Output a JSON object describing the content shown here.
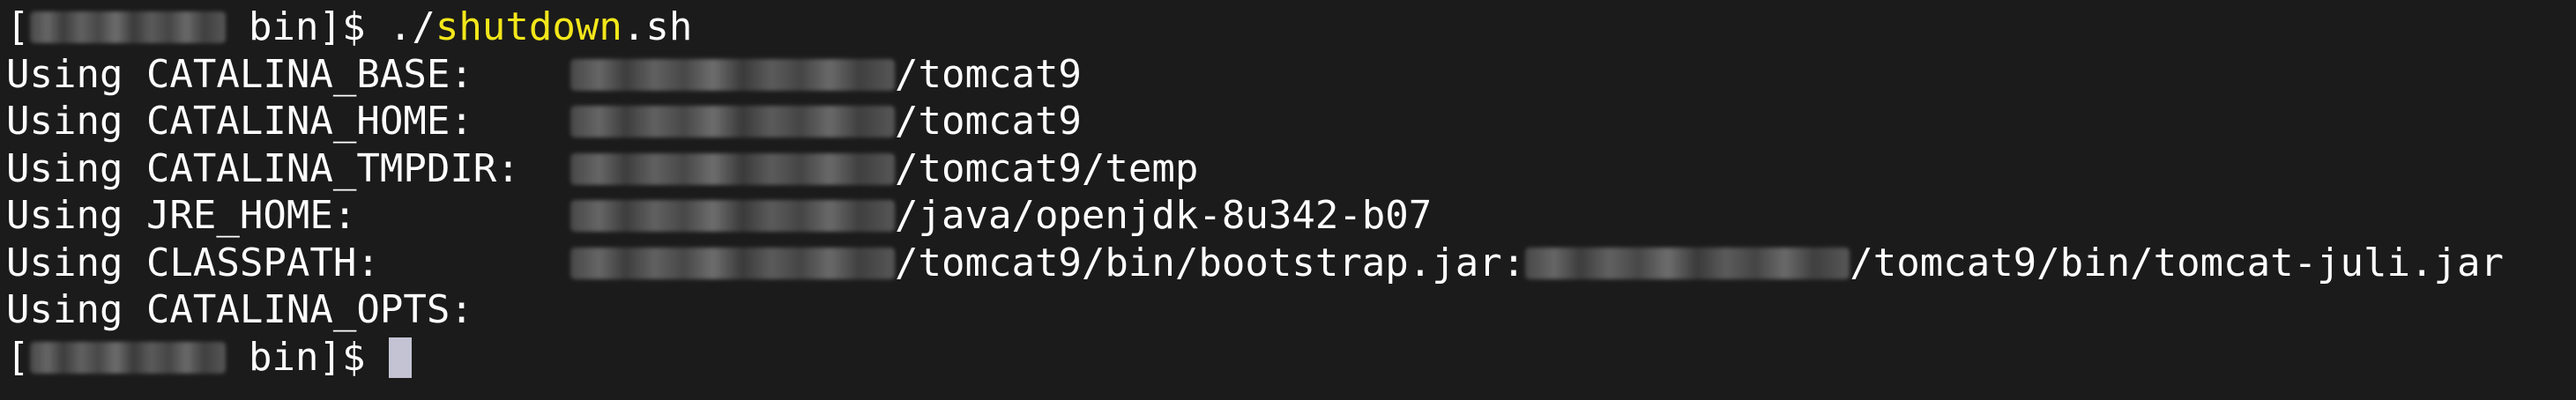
{
  "prompt": {
    "open_bracket": "[",
    "dir_and_close": " bin]$ ",
    "hidden_user_host": "user@host"
  },
  "command": {
    "prefix": "./",
    "highlight": "shutdown",
    "suffix": ".sh"
  },
  "output": [
    {
      "label": "Using CATALINA_BASE:",
      "value": "/tomcat9"
    },
    {
      "label": "Using CATALINA_HOME:",
      "value": "/tomcat9"
    },
    {
      "label": "Using CATALINA_TMPDIR:",
      "value": "/tomcat9/temp"
    },
    {
      "label": "Using JRE_HOME:",
      "value": "/java/openjdk-8u342-b07"
    },
    {
      "label": "Using CLASSPATH:",
      "value": "/tomcat9/bin/bootstrap.jar:",
      "value2": "/tomcat9/bin/tomcat-juli.jar"
    },
    {
      "label": "Using CATALINA_OPTS:",
      "value": ""
    }
  ],
  "colors": {
    "background": "#1b1b1b",
    "text": "#ffffff",
    "highlight": "#f3e71a",
    "cursor": "#c3c3d3"
  }
}
